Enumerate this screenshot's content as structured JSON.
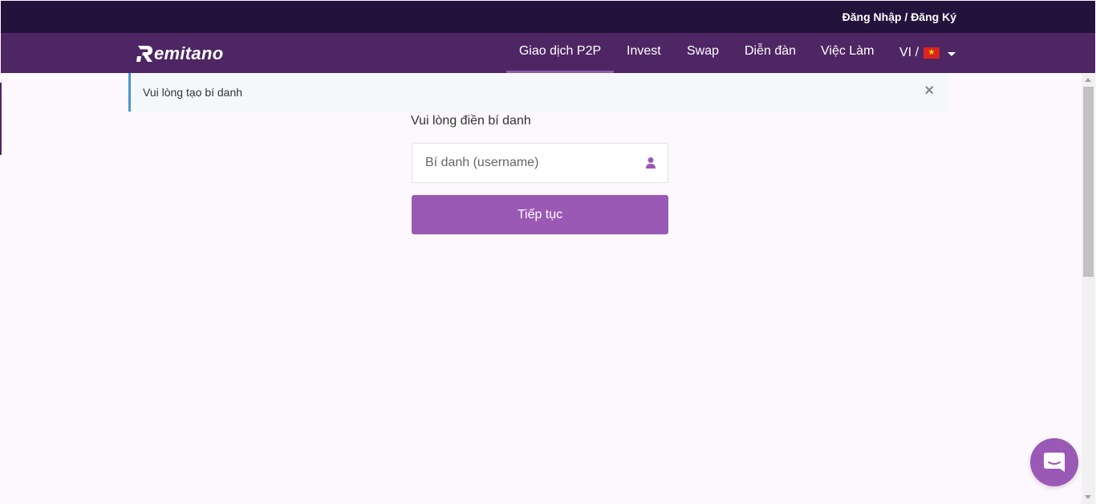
{
  "topbar": {
    "auth_link": "Đăng Nhập / Đăng Ký"
  },
  "header": {
    "logo_text": "emitano",
    "nav": [
      {
        "label": "Giao dịch P2P",
        "active": true
      },
      {
        "label": "Invest"
      },
      {
        "label": "Swap"
      },
      {
        "label": "Diễn đàn"
      },
      {
        "label": "Việc Làm"
      }
    ],
    "lang": {
      "label": "VI /",
      "flag": "vietnam-flag-icon"
    }
  },
  "alert": {
    "text": "Vui lòng tạo bí danh",
    "close_symbol": "×"
  },
  "form": {
    "label": "Vui lòng điền bí danh",
    "username_placeholder": "Bí danh (username)",
    "username_value": "",
    "submit_label": "Tiếp tục"
  },
  "colors": {
    "topbar": "#22123c",
    "navbar": "#4f2664",
    "accent": "#9b59b6",
    "alert_border": "#4a97cb",
    "page_bg": "#fcf8fd"
  },
  "icons": {
    "user": "user-icon",
    "chat": "chat-icon",
    "close": "close-icon",
    "caret": "caret-down-icon"
  }
}
